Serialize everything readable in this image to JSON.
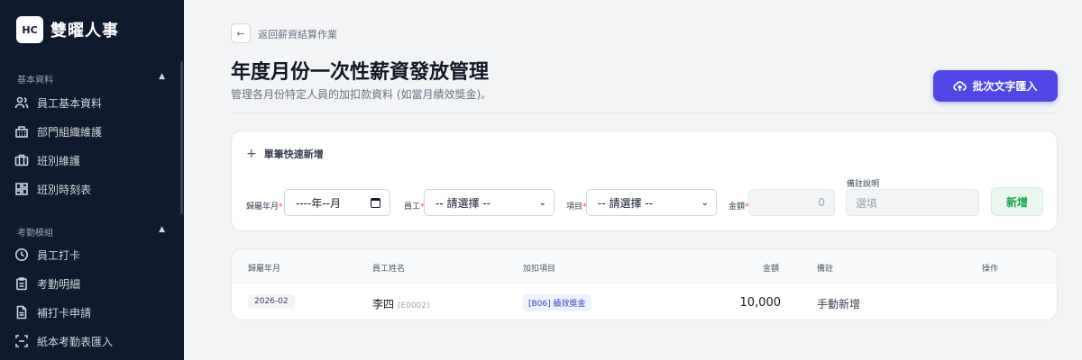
{
  "sidebar": {
    "logo": "HC",
    "brand": "雙曜人事",
    "sections": [
      {
        "title": "基本資料",
        "items": [
          {
            "icon": "users-icon",
            "label": "員工基本資料"
          },
          {
            "icon": "building-icon",
            "label": "部門組織維護"
          },
          {
            "icon": "briefcase-icon",
            "label": "班別維護"
          },
          {
            "icon": "grid-icon",
            "label": "班別時刻表"
          }
        ]
      },
      {
        "title": "考勤模組",
        "items": [
          {
            "icon": "clock-icon",
            "label": "員工打卡"
          },
          {
            "icon": "clipboard-icon",
            "label": "考勤明細"
          },
          {
            "icon": "document-icon",
            "label": "補打卡申請"
          },
          {
            "icon": "scan-icon",
            "label": "紙本考勤表匯入"
          }
        ]
      }
    ]
  },
  "header": {
    "back_label": "返回薪資結算作業",
    "title": "年度月份一次性薪資發放管理",
    "subtitle": "管理各月份特定人員的加扣款資料 (如當月績效獎金)。",
    "import_button": "批次文字匯入"
  },
  "quick_add": {
    "title": "單筆快速新增",
    "fields": {
      "month_label": "歸屬年月",
      "month_value": "----年--月",
      "employee_label": "員工",
      "employee_value": "-- 請選擇 --",
      "item_label": "項目",
      "item_value": "-- 請選擇 --",
      "amount_label": "金額",
      "amount_placeholder": "0",
      "note_label": "備註說明",
      "note_placeholder": "選填"
    },
    "required_mark": "*",
    "add_button": "新增"
  },
  "table": {
    "columns": [
      "歸屬年月",
      "員工姓名",
      "加扣項目",
      "金額",
      "備註",
      "操作"
    ],
    "rows": [
      {
        "month": "2026-02",
        "name": "李四",
        "emp_id": "(E0002)",
        "item": "[B06] 績效獎金",
        "amount": "10,000",
        "note": "手動新增",
        "action": ""
      }
    ]
  },
  "colors": {
    "sidebar_bg": "#0f1a2e",
    "primary": "#4f46e5",
    "success": "#16a34a"
  }
}
